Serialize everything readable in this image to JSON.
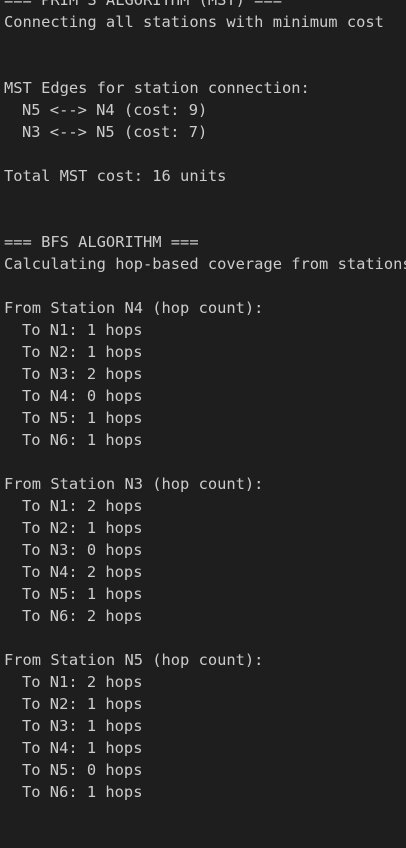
{
  "terminal": {
    "lines": [
      {
        "text": "=== PRIM'S ALGORITHM (MST) ===",
        "indent": false
      },
      {
        "text": "Connecting all stations with minimum cost",
        "indent": false
      },
      {
        "text": "",
        "indent": false
      },
      {
        "text": "",
        "indent": false
      },
      {
        "text": "MST Edges for station connection:",
        "indent": false
      },
      {
        "text": "N5 <--> N4 (cost: 9)",
        "indent": true
      },
      {
        "text": "N3 <--> N5 (cost: 7)",
        "indent": true
      },
      {
        "text": "",
        "indent": false
      },
      {
        "text": "Total MST cost: 16 units",
        "indent": false
      },
      {
        "text": "",
        "indent": false
      },
      {
        "text": "",
        "indent": false
      },
      {
        "text": "=== BFS ALGORITHM ===",
        "indent": false
      },
      {
        "text": "Calculating hop-based coverage from stations",
        "indent": false
      },
      {
        "text": "",
        "indent": false
      },
      {
        "text": "From Station N4 (hop count):",
        "indent": false
      },
      {
        "text": "To N1: 1 hops",
        "indent": true
      },
      {
        "text": "To N2: 1 hops",
        "indent": true
      },
      {
        "text": "To N3: 2 hops",
        "indent": true
      },
      {
        "text": "To N4: 0 hops",
        "indent": true
      },
      {
        "text": "To N5: 1 hops",
        "indent": true
      },
      {
        "text": "To N6: 1 hops",
        "indent": true
      },
      {
        "text": "",
        "indent": false
      },
      {
        "text": "From Station N3 (hop count):",
        "indent": false
      },
      {
        "text": "To N1: 2 hops",
        "indent": true
      },
      {
        "text": "To N2: 1 hops",
        "indent": true
      },
      {
        "text": "To N3: 0 hops",
        "indent": true
      },
      {
        "text": "To N4: 2 hops",
        "indent": true
      },
      {
        "text": "To N5: 1 hops",
        "indent": true
      },
      {
        "text": "To N6: 2 hops",
        "indent": true
      },
      {
        "text": "",
        "indent": false
      },
      {
        "text": "From Station N5 (hop count):",
        "indent": false
      },
      {
        "text": "To N1: 2 hops",
        "indent": true
      },
      {
        "text": "To N2: 1 hops",
        "indent": true
      },
      {
        "text": "To N3: 1 hops",
        "indent": true
      },
      {
        "text": "To N4: 1 hops",
        "indent": true
      },
      {
        "text": "To N5: 0 hops",
        "indent": true
      },
      {
        "text": "To N6: 1 hops",
        "indent": true
      }
    ]
  },
  "colors": {
    "background": "#1e1e1e",
    "text": "#cccccc"
  }
}
